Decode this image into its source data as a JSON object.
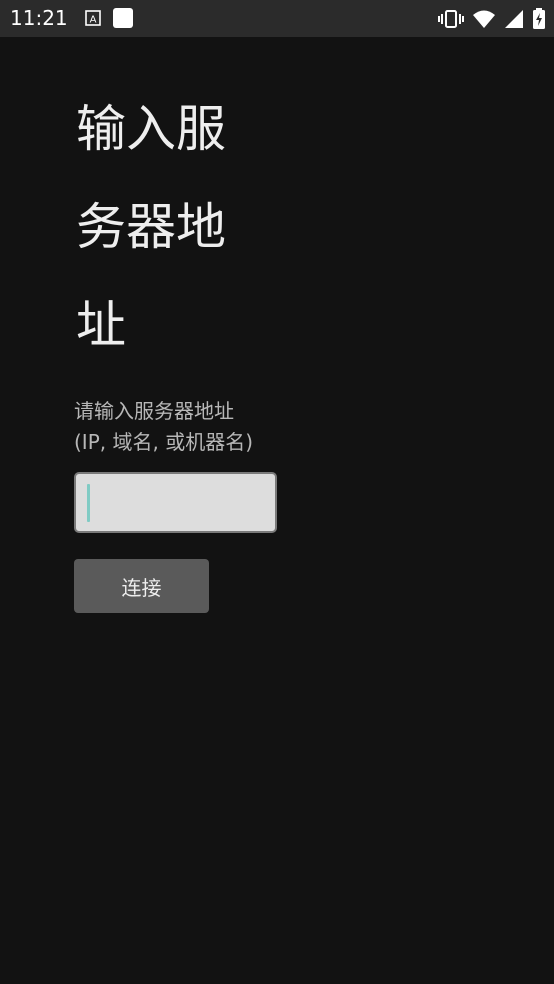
{
  "status_bar": {
    "time": "11:21",
    "icons_left": [
      "text-a-icon",
      "white-square-icon"
    ],
    "icons_right": [
      "vibrate-icon",
      "wifi-icon",
      "signal-icon",
      "battery-icon"
    ]
  },
  "main": {
    "title_lines": [
      "输入服",
      "务器地",
      "址"
    ],
    "hint_lines": [
      "请输入服务器地址",
      "(IP, 域名, 或机器名)"
    ],
    "input": {
      "value": "",
      "placeholder": ""
    },
    "connect_label": "连接"
  },
  "colors": {
    "background": "#121212",
    "status_bar": "#2b2b2b",
    "input_bg": "#dddddd",
    "button": "#5a5a5a",
    "caret": "#80cbc4"
  }
}
